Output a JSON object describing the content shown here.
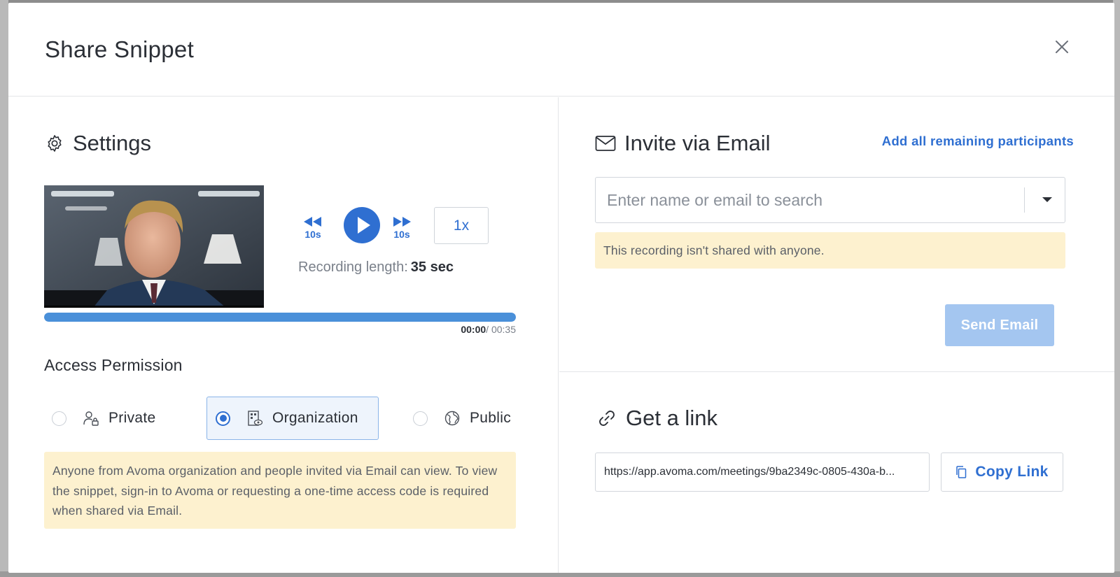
{
  "modal": {
    "title": "Share Snippet"
  },
  "settings": {
    "title": "Settings",
    "rewind_label": "10s",
    "forward_label": "10s",
    "speed": "1x",
    "recording_length_label": "Recording length:",
    "recording_length_value": "35 sec",
    "progress_fraction": 1.0,
    "time_current": "00:00",
    "time_total": "/ 00:35"
  },
  "access": {
    "heading": "Access Permission",
    "options": [
      {
        "label": "Private",
        "icon": "user-lock-icon",
        "selected": false
      },
      {
        "label": "Organization",
        "icon": "building-eye-icon",
        "selected": true
      },
      {
        "label": "Public",
        "icon": "globe-icon",
        "selected": false
      }
    ],
    "note": "Anyone from Avoma organization and people invited via Email can view. To view the snippet, sign-in to Avoma or requesting a one-time access code is required when shared via Email."
  },
  "invite": {
    "title": "Invite via Email",
    "add_all_link": "Add all remaining participants",
    "search_placeholder": "Enter name or email to search",
    "share_note": "This recording isn't shared with anyone.",
    "send_button": "Send Email"
  },
  "link": {
    "title": "Get a link",
    "url": "https://app.avoma.com/meetings/9ba2349c-0805-430a-b...",
    "copy_button": "Copy Link"
  },
  "colors": {
    "accent": "#2f6fd1",
    "progress": "#4a90d9",
    "note_bg": "#fdf1cf",
    "disabled_button": "#a4c6f0"
  }
}
